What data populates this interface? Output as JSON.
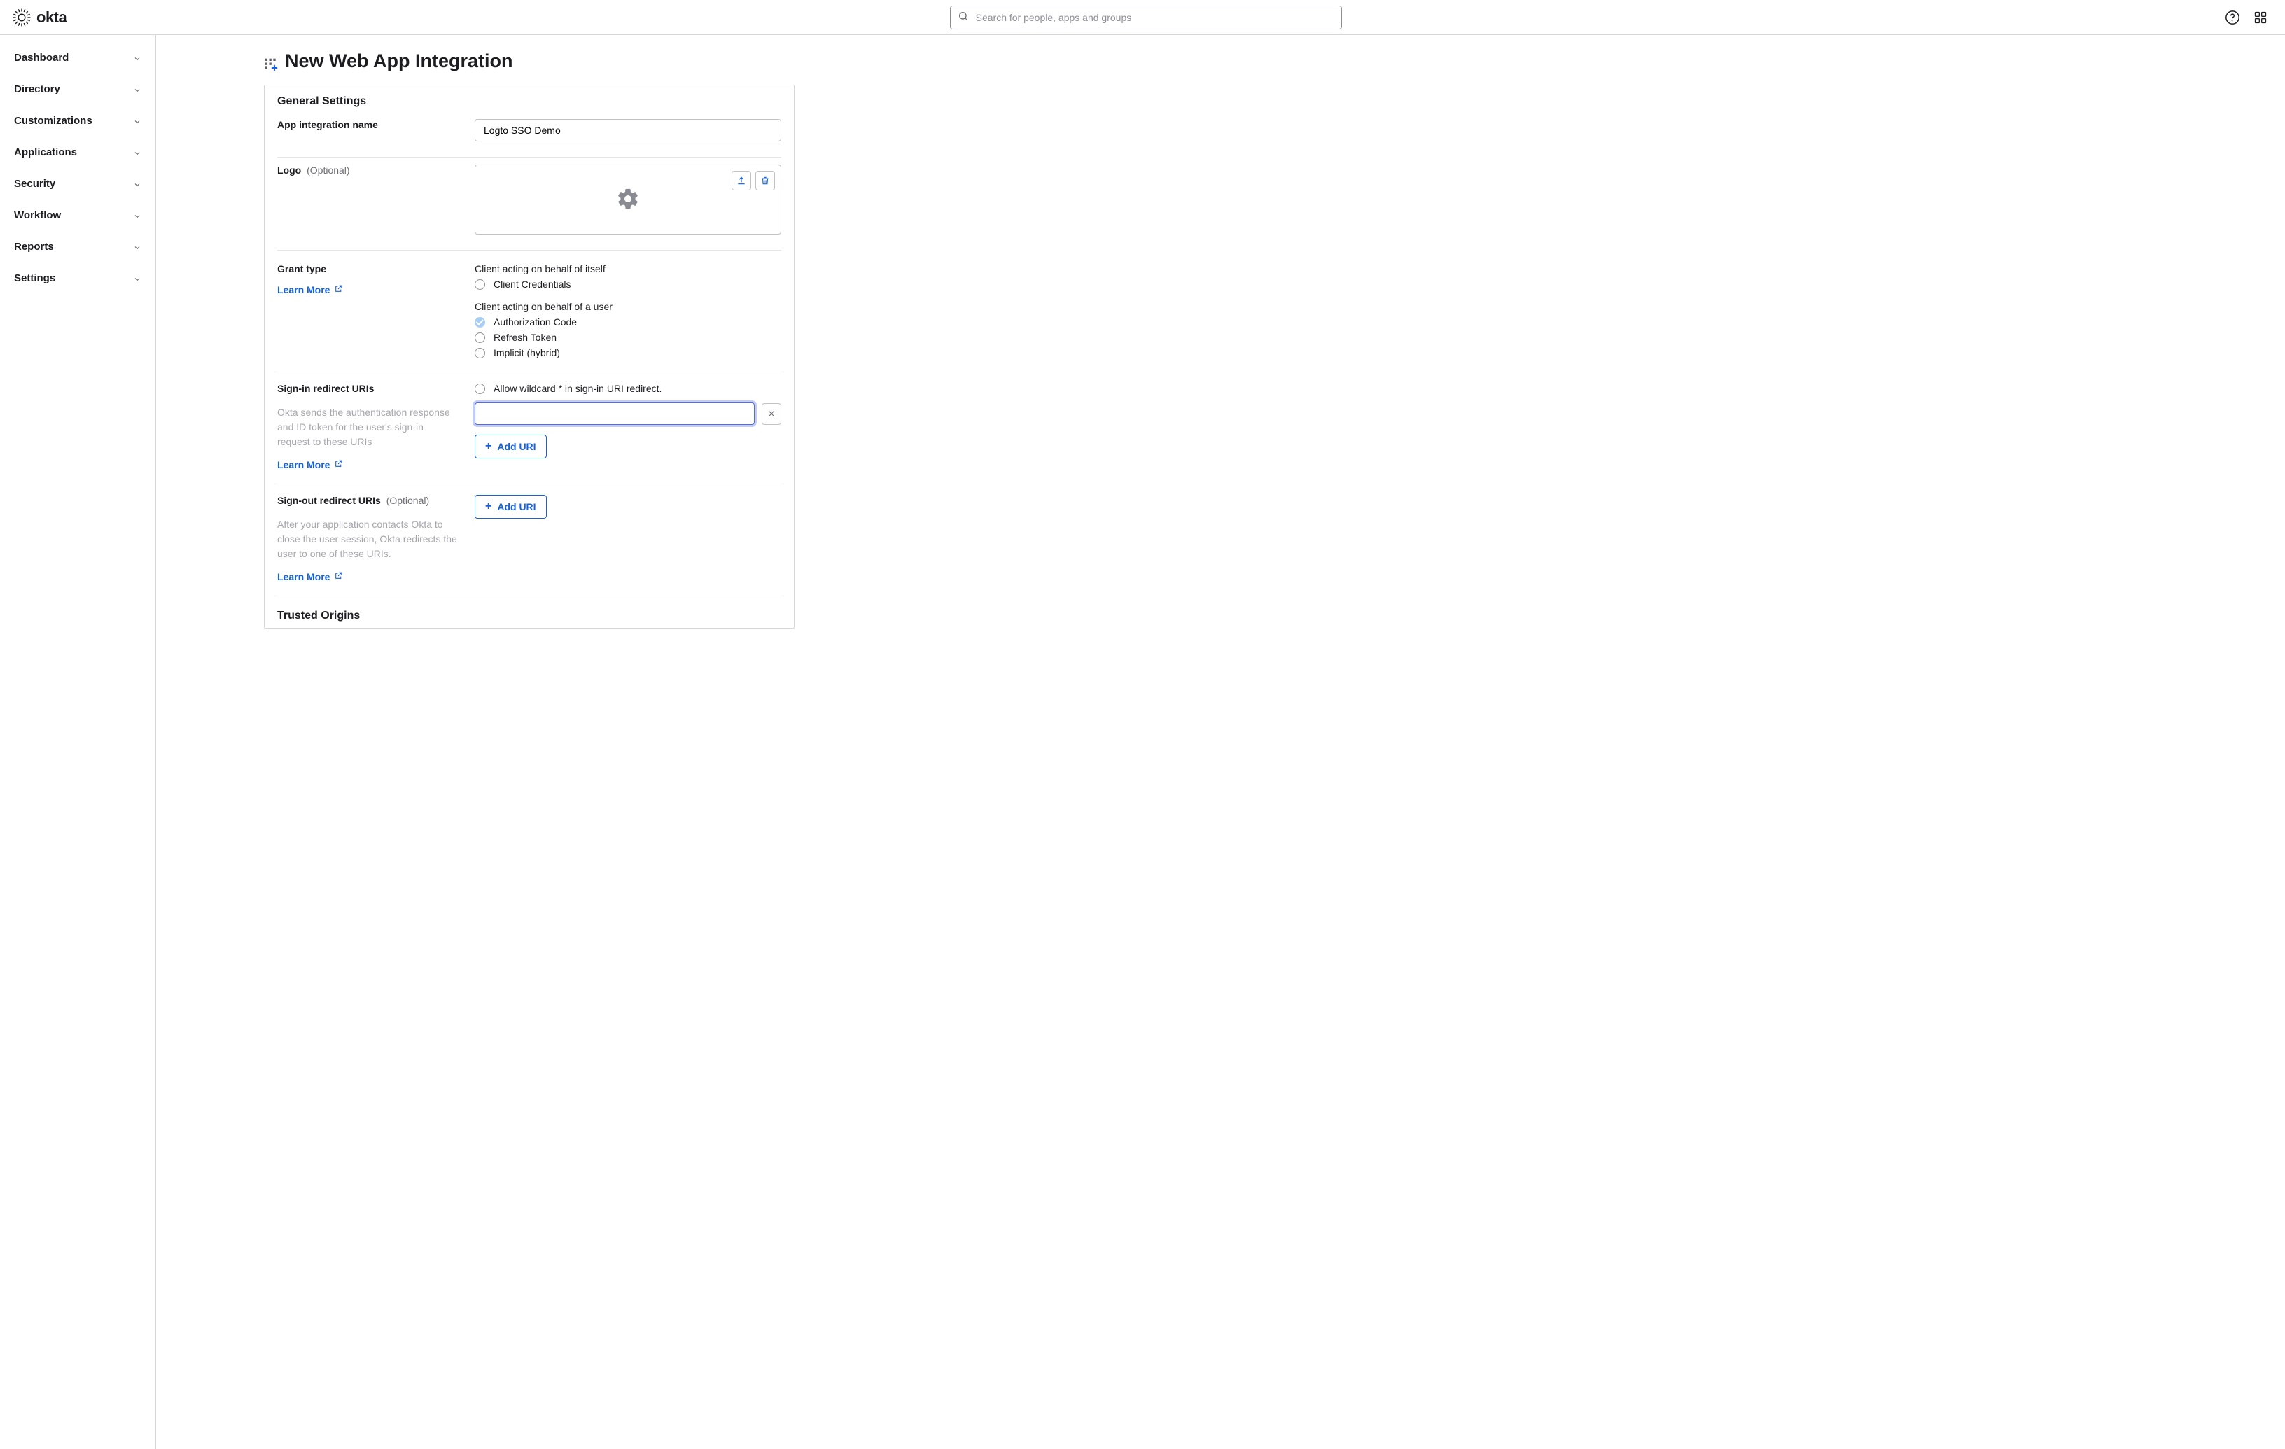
{
  "brand": "okta",
  "search": {
    "placeholder": "Search for people, apps and groups"
  },
  "sidebar": {
    "items": [
      {
        "label": "Dashboard"
      },
      {
        "label": "Directory"
      },
      {
        "label": "Customizations"
      },
      {
        "label": "Applications"
      },
      {
        "label": "Security"
      },
      {
        "label": "Workflow"
      },
      {
        "label": "Reports"
      },
      {
        "label": "Settings"
      }
    ]
  },
  "page": {
    "title": "New Web App Integration",
    "card_title": "General Settings",
    "app_name": {
      "label": "App integration name",
      "value": "Logto SSO Demo"
    },
    "logo": {
      "label": "Logo",
      "optional": "(Optional)"
    },
    "grant": {
      "label": "Grant type",
      "learn_more": "Learn More",
      "self_heading": "Client acting on behalf of itself",
      "user_heading": "Client acting on behalf of a user",
      "options": {
        "client_credentials": "Client Credentials",
        "authorization_code": "Authorization Code",
        "refresh_token": "Refresh Token",
        "implicit_hybrid": "Implicit (hybrid)"
      }
    },
    "signin": {
      "label": "Sign-in redirect URIs",
      "wildcard": "Allow wildcard * in sign-in URI redirect.",
      "desc": "Okta sends the authentication response and ID token for the user's sign-in request to these URIs",
      "learn_more": "Learn More",
      "value": "",
      "add": "Add URI"
    },
    "signout": {
      "label": "Sign-out redirect URIs",
      "optional": "(Optional)",
      "desc": "After your application contacts Okta to close the user session, Okta redirects the user to one of these URIs.",
      "learn_more": "Learn More",
      "add": "Add URI"
    },
    "trusted_origins": {
      "label": "Trusted Origins"
    }
  }
}
